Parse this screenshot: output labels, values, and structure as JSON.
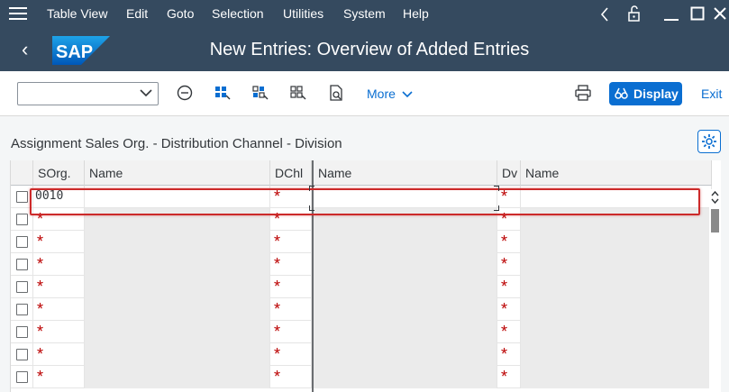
{
  "menu": {
    "items": [
      "Table View",
      "Edit",
      "Goto",
      "Selection",
      "Utilities",
      "System",
      "Help"
    ],
    "window_icons": [
      "back-icon",
      "lock-icon",
      "minimize-icon",
      "maximize-icon",
      "close-icon"
    ]
  },
  "header": {
    "logo_text": "SAP",
    "title": "New Entries: Overview of Added Entries"
  },
  "toolbar": {
    "combo_value": "",
    "more_label": "More",
    "display_label": "Display",
    "exit_label": "Exit"
  },
  "section": {
    "title": "Assignment Sales Org. - Distribution Channel - Division"
  },
  "table": {
    "columns": [
      "SOrg.",
      "Name",
      "DChl",
      "Name",
      "Dv",
      "Name"
    ],
    "required_marker": "*",
    "rows": [
      {
        "sorg": "0010",
        "dchl": "",
        "dv": ""
      },
      {
        "sorg": "",
        "dchl": "",
        "dv": ""
      },
      {
        "sorg": "",
        "dchl": "",
        "dv": ""
      },
      {
        "sorg": "",
        "dchl": "",
        "dv": ""
      },
      {
        "sorg": "",
        "dchl": "",
        "dv": ""
      },
      {
        "sorg": "",
        "dchl": "",
        "dv": ""
      },
      {
        "sorg": "",
        "dchl": "",
        "dv": ""
      },
      {
        "sorg": "",
        "dchl": "",
        "dv": ""
      },
      {
        "sorg": "",
        "dchl": "",
        "dv": ""
      }
    ]
  },
  "colors": {
    "shell": "#354a5f",
    "accent": "#0a6ed1",
    "required": "#bb0000",
    "highlight": "#cc2a2a"
  }
}
